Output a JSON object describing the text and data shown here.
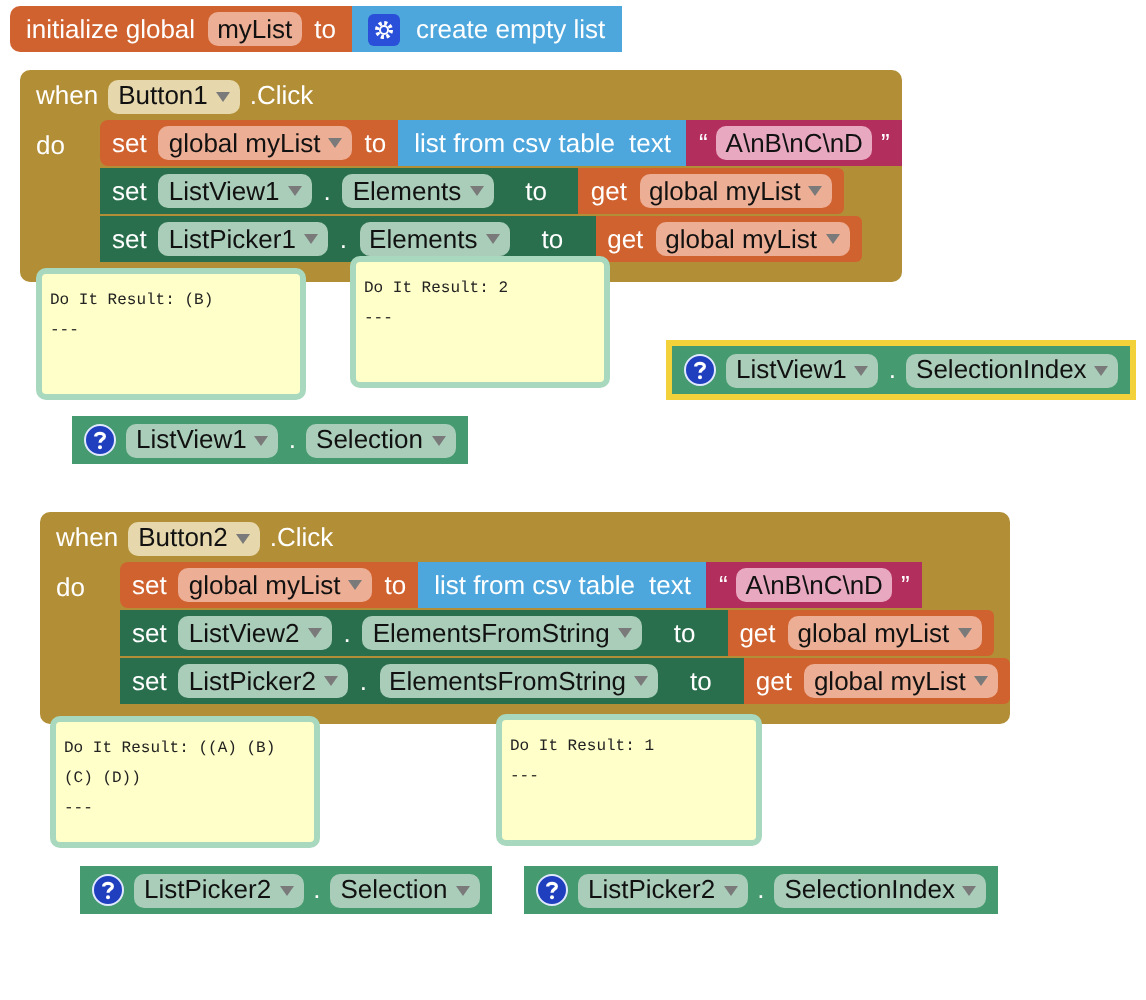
{
  "init": {
    "keyword": "initialize global",
    "name": "myList",
    "to": "to",
    "value": "create empty list"
  },
  "events": [
    {
      "when": "when",
      "component": "Button1",
      "event": ".Click",
      "do": "do",
      "statements": [
        {
          "kind": "set_global",
          "set": "set",
          "target": "global myList",
          "to": "to",
          "label": "list from csv table",
          "param": "text",
          "open_quote": "“",
          "string": "A\\nB\\nC\\nD",
          "close_quote": "”"
        },
        {
          "kind": "set_property",
          "set": "set",
          "component": "ListView1",
          "dot": ".",
          "property": "Elements",
          "to": "to",
          "get": "get",
          "variable": "global myList"
        },
        {
          "kind": "set_property",
          "set": "set",
          "component": "ListPicker1",
          "dot": ".",
          "property": "Elements",
          "to": "to",
          "get": "get",
          "variable": "global myList"
        }
      ]
    },
    {
      "when": "when",
      "component": "Button2",
      "event": ".Click",
      "do": "do",
      "statements": [
        {
          "kind": "set_global",
          "set": "set",
          "target": "global myList",
          "to": "to",
          "label": "list from csv table",
          "param": "text",
          "open_quote": "“",
          "string": "A\\nB\\nC\\nD",
          "close_quote": "”"
        },
        {
          "kind": "set_property",
          "set": "set",
          "component": "ListView2",
          "dot": ".",
          "property": "ElementsFromString",
          "to": "to",
          "get": "get",
          "variable": "global myList"
        },
        {
          "kind": "set_property",
          "set": "set",
          "component": "ListPicker2",
          "dot": ".",
          "property": "ElementsFromString",
          "to": "to",
          "get": "get",
          "variable": "global myList"
        }
      ]
    }
  ],
  "getters": [
    {
      "component": "ListView1",
      "dot": ".",
      "property": "Selection",
      "selected": false,
      "comment": [
        "Do It Result: (B)",
        "---"
      ]
    },
    {
      "component": "ListView1",
      "dot": ".",
      "property": "SelectionIndex",
      "selected": true,
      "comment": [
        "Do It Result: 2",
        "---"
      ]
    },
    {
      "component": "ListPicker2",
      "dot": ".",
      "property": "Selection",
      "selected": false,
      "comment": [
        "Do It Result: ((A) (B) (C) (D))",
        "---"
      ]
    },
    {
      "component": "ListPicker2",
      "dot": ".",
      "property": "SelectionIndex",
      "selected": false,
      "comment": [
        "Do It Result: 1",
        "---"
      ]
    }
  ]
}
